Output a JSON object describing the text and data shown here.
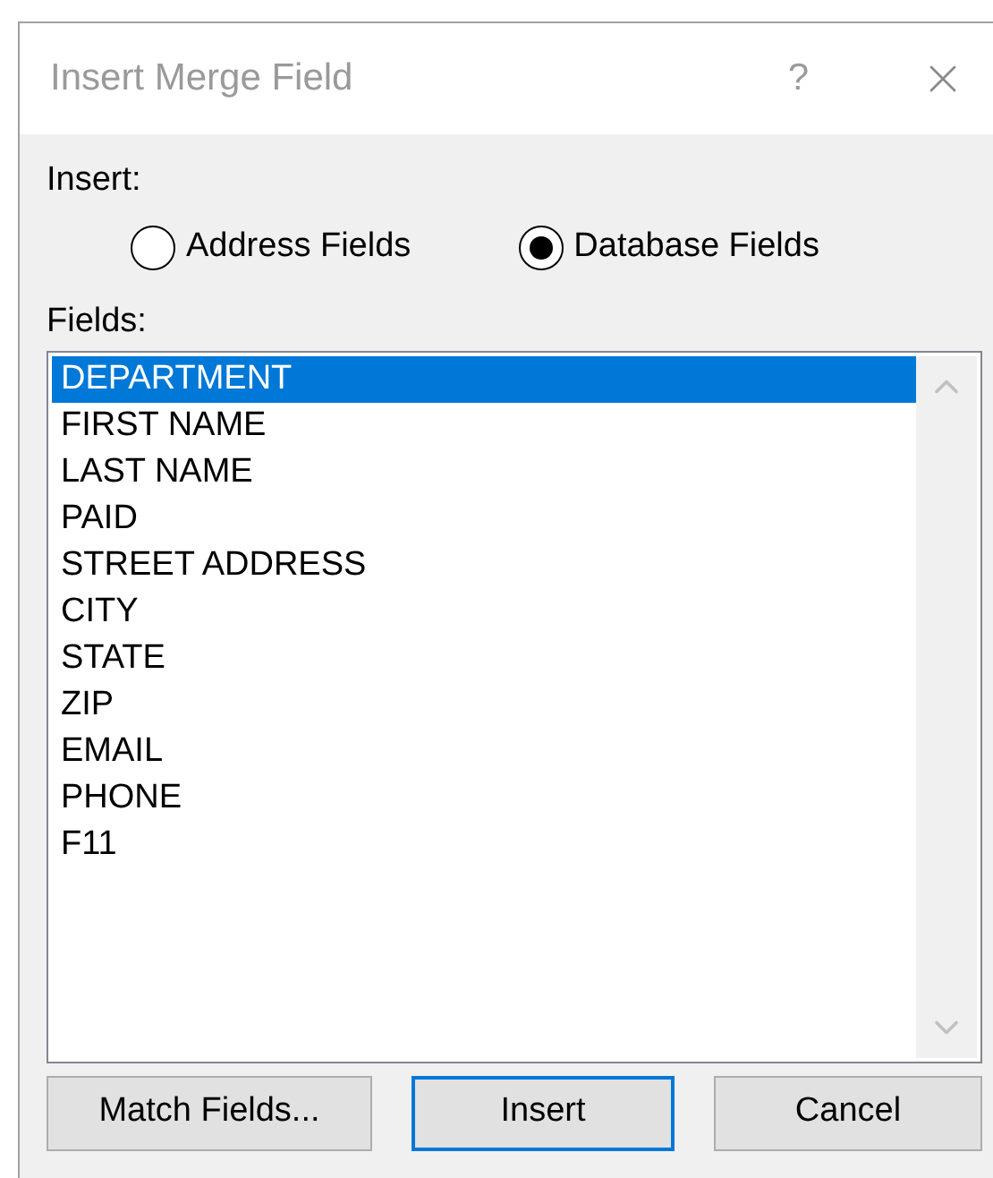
{
  "window": {
    "title": "Insert Merge Field",
    "help": "?"
  },
  "insert": {
    "label": "Insert:",
    "options": [
      {
        "label": "Address Fields",
        "selected": false
      },
      {
        "label": "Database Fields",
        "selected": true
      }
    ]
  },
  "fields": {
    "label": "Fields:",
    "items": [
      {
        "label": "DEPARTMENT",
        "selected": true
      },
      {
        "label": "FIRST NAME",
        "selected": false
      },
      {
        "label": "LAST NAME",
        "selected": false
      },
      {
        "label": "PAID",
        "selected": false
      },
      {
        "label": "STREET ADDRESS",
        "selected": false
      },
      {
        "label": "CITY",
        "selected": false
      },
      {
        "label": "STATE",
        "selected": false
      },
      {
        "label": "ZIP",
        "selected": false
      },
      {
        "label": "EMAIL",
        "selected": false
      },
      {
        "label": "PHONE",
        "selected": false
      },
      {
        "label": "F11",
        "selected": false
      }
    ]
  },
  "buttons": [
    {
      "label": "Match Fields...",
      "default": false
    },
    {
      "label": "Insert",
      "default": true
    },
    {
      "label": "Cancel",
      "default": false
    }
  ]
}
